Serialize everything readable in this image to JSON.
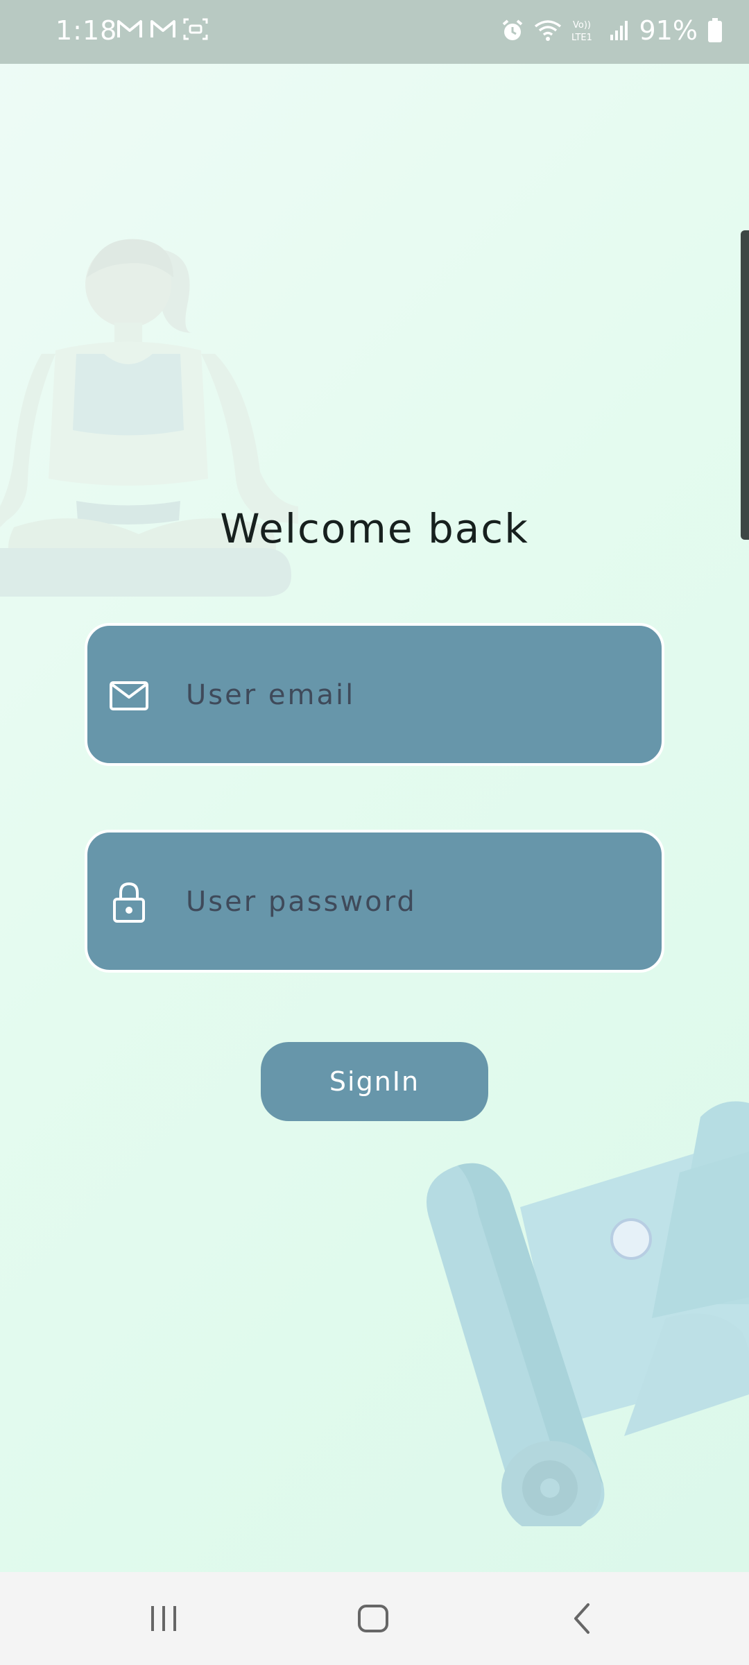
{
  "status_bar": {
    "time": "1:18",
    "left_icons": [
      "gmail-icon",
      "gmail-icon",
      "screen-record-icon"
    ],
    "right_icons": [
      "alarm-icon",
      "wifi-icon",
      "volte-lte-icon",
      "signal-icon",
      "battery-icon"
    ],
    "network_label": "Vo)) LTE1",
    "battery_percent": "91%"
  },
  "login": {
    "title": "Welcome back",
    "email_placeholder": "User email",
    "password_placeholder": "User password",
    "signin_label": "SignIn"
  },
  "colors": {
    "field_background": "#6796aa",
    "button_background": "#6796aa",
    "page_background": "#e4fbef",
    "status_bar": "#b8c9c2"
  },
  "navigation": {
    "items": [
      "recents-icon",
      "home-icon",
      "back-icon"
    ]
  }
}
